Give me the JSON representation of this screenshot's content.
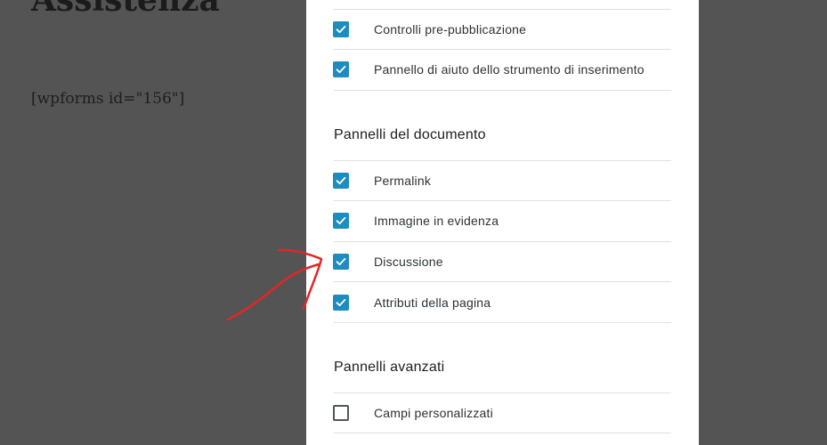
{
  "page": {
    "title": "Assistenza",
    "shortcode": "[wpforms id=\"156\"]"
  },
  "modal": {
    "top_options": [
      {
        "label": "Controlli pre-pubblicazione",
        "checked": true
      },
      {
        "label": "Pannello di aiuto dello strumento di inserimento",
        "checked": true
      }
    ],
    "document_panels": {
      "title": "Pannelli del documento",
      "options": [
        {
          "label": "Permalink",
          "checked": true
        },
        {
          "label": "Immagine in evidenza",
          "checked": true
        },
        {
          "label": "Discussione",
          "checked": true
        },
        {
          "label": "Attributi della pagina",
          "checked": true
        }
      ]
    },
    "advanced_panels": {
      "title": "Pannelli avanzati",
      "options": [
        {
          "label": "Campi personalizzati",
          "checked": false
        }
      ]
    }
  },
  "colors": {
    "overlay": "#545454",
    "checkbox_accent": "#1e8cbe",
    "annotation": "#e0262a"
  },
  "icons": {
    "checked": "checkmark-icon",
    "annotation": "red-hand-drawn-arrow"
  }
}
